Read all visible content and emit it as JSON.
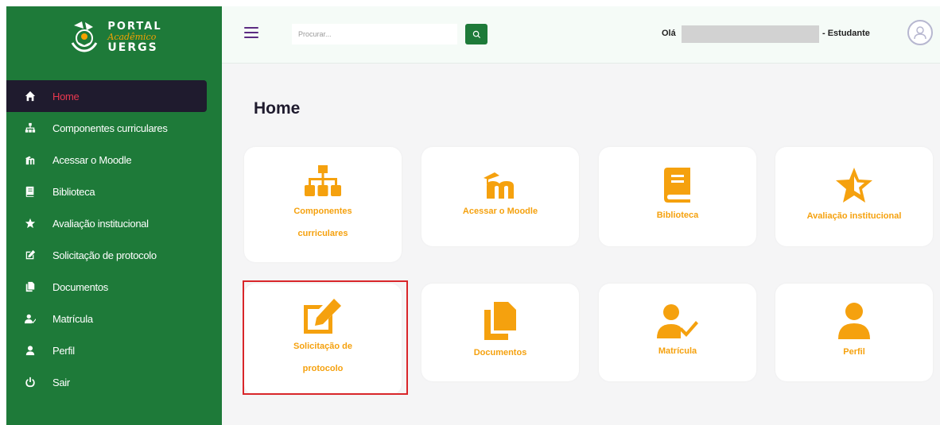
{
  "logo": {
    "line1": "PORTAL",
    "line2": "Acadêmico",
    "line3": "UERGS"
  },
  "sidebar": {
    "items": [
      {
        "label": "Home",
        "icon": "home-icon",
        "active": true
      },
      {
        "label": "Componentes curriculares",
        "icon": "sitemap-icon"
      },
      {
        "label": "Acessar o Moodle",
        "icon": "moodle-icon"
      },
      {
        "label": "Biblioteca",
        "icon": "book-icon"
      },
      {
        "label": "Avaliação institucional",
        "icon": "star-icon"
      },
      {
        "label": "Solicitação de protocolo",
        "icon": "edit-icon"
      },
      {
        "label": "Documentos",
        "icon": "copy-icon"
      },
      {
        "label": "Matrícula",
        "icon": "user-check-icon"
      },
      {
        "label": "Perfil",
        "icon": "user-icon"
      },
      {
        "label": "Sair",
        "icon": "power-icon"
      }
    ]
  },
  "topbar": {
    "search_placeholder": "Procurar...",
    "greeting": "Olá",
    "role": "- Estudante"
  },
  "main": {
    "title": "Home",
    "cards": [
      {
        "label": "Componentes curriculares",
        "icon": "sitemap-icon"
      },
      {
        "label": "Acessar o Moodle",
        "icon": "moodle-icon"
      },
      {
        "label": "Biblioteca",
        "icon": "book-icon"
      },
      {
        "label": "Avaliação institucional",
        "icon": "star-icon"
      },
      {
        "label": "Solicitação de protocolo",
        "icon": "edit-icon"
      },
      {
        "label": "Documentos",
        "icon": "copy-icon"
      },
      {
        "label": "Matrícula",
        "icon": "user-check-icon"
      },
      {
        "label": "Perfil",
        "icon": "user-icon"
      }
    ]
  },
  "colors": {
    "sidebar_bg": "#1e7a39",
    "active_bg": "#1f1b2e",
    "active_text": "#e8384f",
    "accent_orange": "#f5a10e",
    "highlight_border": "#d9262a"
  }
}
